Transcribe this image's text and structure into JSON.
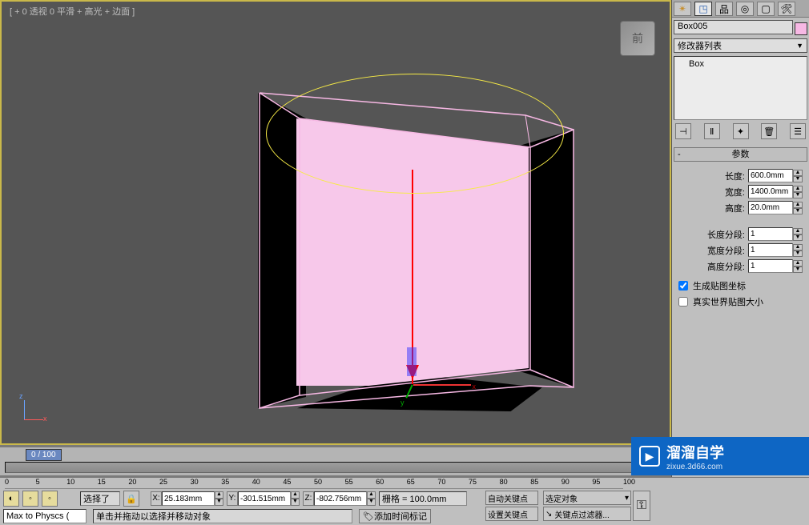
{
  "viewport": {
    "label": "[ + 0 透视 0 平滑 + 高光 + 边面 ]",
    "cube_face": "前"
  },
  "axis": {
    "x": "x",
    "z": "z"
  },
  "object_gizmo": {
    "x": "x",
    "y": "y"
  },
  "panel": {
    "object_name": "Box005",
    "modifier_dropdown": "修改器列表",
    "stack_item": "Box",
    "rollout_title": "参数",
    "length_label": "长度:",
    "length_value": "600.0mm",
    "width_label": "宽度:",
    "width_value": "1400.0mm",
    "height_label": "高度:",
    "height_value": "20.0mm",
    "lseg_label": "长度分段:",
    "lseg_value": "1",
    "wseg_label": "宽度分段:",
    "wseg_value": "1",
    "hseg_label": "高度分段:",
    "hseg_value": "1",
    "gen_mapping": "生成贴图坐标",
    "real_world": "真实世界贴图大小"
  },
  "timeline": {
    "indicator": "0 / 100",
    "ticks": [
      "0",
      "5",
      "10",
      "15",
      "20",
      "25",
      "30",
      "35",
      "40",
      "45",
      "50",
      "55",
      "60",
      "65",
      "70",
      "75",
      "80",
      "85",
      "90",
      "95",
      "100"
    ]
  },
  "status": {
    "script_btn": "Max to Physcs (",
    "sel_label": "选择了",
    "coord_x_label": "X:",
    "coord_x": "25.183mm",
    "coord_y_label": "Y:",
    "coord_y": "-301.515mm",
    "coord_z_label": "Z:",
    "coord_z": "-802.756mm",
    "grid": "栅格 = 100.0mm",
    "prompt": "单击并拖动以选择并移动对象",
    "add_time_tag": "添加时间标记",
    "auto_key": "自动关键点",
    "set_key": "设置关键点",
    "sel_obj": "选定对象",
    "key_filter": "关键点过滤器..."
  },
  "watermark": {
    "brand": "溜溜自学",
    "url": "zixue.3d66.com"
  }
}
